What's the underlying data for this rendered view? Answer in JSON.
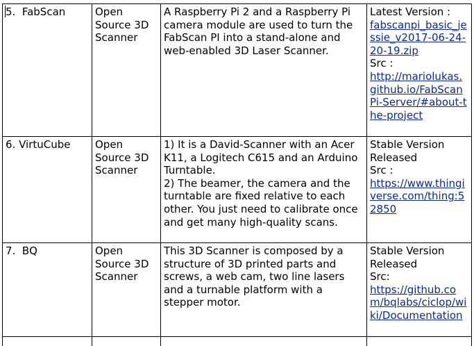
{
  "table": {
    "rows": [
      {
        "index": "5.  FabScan",
        "category": "Open Source 3D Scanner",
        "description": [
          "A Raspberry Pi 2 and a Raspberry Pi camera module are used to turn the FabScan PI into a stand-alone and web-enabled 3D Laser Scanner."
        ],
        "status_label": "Latest Version :",
        "status_link": "fabscanpi_basic_jessie_v2017-06-24-20-19.zip",
        "src_label": "Src :",
        "src_link": "http://mariolukas.github.io/FabScanPi-Server/#about-the-project"
      },
      {
        "index": "6. VirtuCube",
        "category": "Open Source 3D Scanner",
        "description": [
          "1) It is a David-Scanner with an Acer K11, a Logitech C615 and an Arduino Turntable.",
          "2) The beamer, the camera and the turntable are fixed relative to each other. You just need to calibrate once and get many high-quality scans."
        ],
        "status_label": "Stable Version Released",
        "src_label": "Src :",
        "src_link": "https://www.thingiverse.com/thing:52850"
      },
      {
        "index": "7.  BQ",
        "category": "Open Source 3D Scanner",
        "description": [
          "This 3D Scanner is composed by a structure of 3D printed parts and screws, a web cam, two line lasers and a turnable platform with a stepper motor."
        ],
        "status_label": "Stable Version Released",
        "src_label": "Src:",
        "src_link": "https://github.com/bqlabs/ciclop/wiki/Documentation"
      }
    ]
  }
}
